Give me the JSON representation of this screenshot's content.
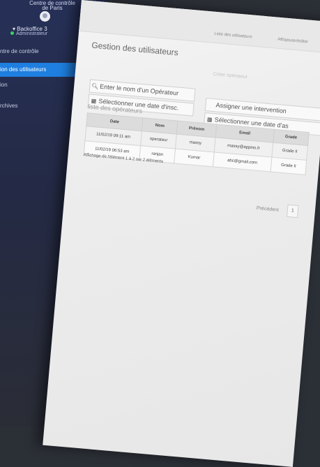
{
  "sidebar": {
    "org_line1": "Centre de contrôle",
    "org_line2": "de Paris",
    "user": "▾ Backoffice 3",
    "role": "Administrateur",
    "items": [
      {
        "label": "ntre de contrôle"
      },
      {
        "label": "ion des utilisateurs"
      },
      {
        "label": "ion"
      },
      {
        "label": "rchives"
      }
    ]
  },
  "topbar": {
    "button1": "Liste des utilisateurs",
    "button2": "Aff/ajouter/éditer"
  },
  "main": {
    "title": "Gestion des utilisateurs",
    "create_label": "Créer opérateur",
    "filters": {
      "operator_name": "Enter le nom d'un Opérateur",
      "inscription_date": "Sélectionner une date d'insc.",
      "assign": "Assigner une intervention",
      "date_right": "Sélectionner une date d'as"
    },
    "section_label": "liste des opérateurs"
  },
  "table": {
    "headers": [
      "Date",
      "Nom",
      "Prénom",
      "Email",
      "Grade"
    ],
    "rows": [
      [
        "11/02/19 09:11 am",
        "operateur",
        "massy",
        "massy@appinn.fr",
        "Grade II"
      ],
      [
        "11/02/19 06:53 am",
        "ranjan",
        "Kumar",
        "abc@gmail.com",
        "Grade II"
      ]
    ],
    "info": "Affichage de l'élément 1 à 2 sur 2 éléments"
  },
  "pagination": {
    "prev": "Précédent",
    "page": "1"
  }
}
